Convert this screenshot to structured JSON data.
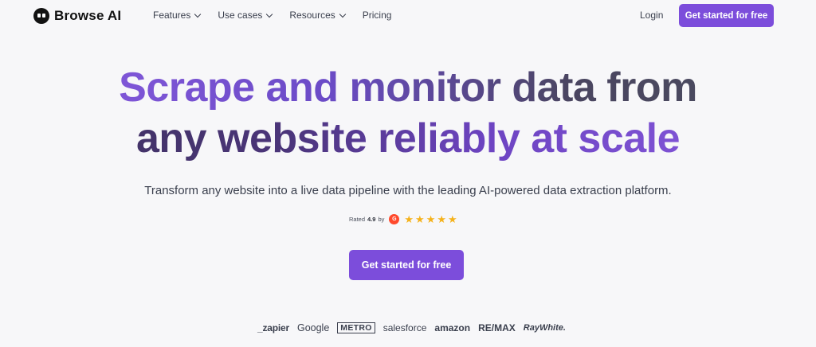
{
  "nav": {
    "brand": "Browse AI",
    "menu": [
      {
        "label": "Features",
        "has_dropdown": true
      },
      {
        "label": "Use cases",
        "has_dropdown": true
      },
      {
        "label": "Resources",
        "has_dropdown": true
      },
      {
        "label": "Pricing",
        "has_dropdown": false
      }
    ],
    "login_label": "Login",
    "cta_label": "Get started for free"
  },
  "hero": {
    "headline_line1": "Scrape and monitor data from",
    "headline_line2": "any website reliably at scale",
    "subtitle": "Transform any website into a live data pipeline with the leading AI-powered data extraction platform.",
    "rating": {
      "prefix": "Rated",
      "score": "4.9",
      "by": "by",
      "provider_badge": "G",
      "stars": 5
    },
    "cta_label": "Get started for free"
  },
  "logos": [
    "_zapier",
    "Google",
    "METRO",
    "salesforce",
    "amazon",
    "RE/MAX",
    "RayWhite."
  ],
  "colors": {
    "accent": "#7c4ddb",
    "background": "#f7f7f9",
    "star": "#f5b21b",
    "g2": "#ff492c"
  }
}
